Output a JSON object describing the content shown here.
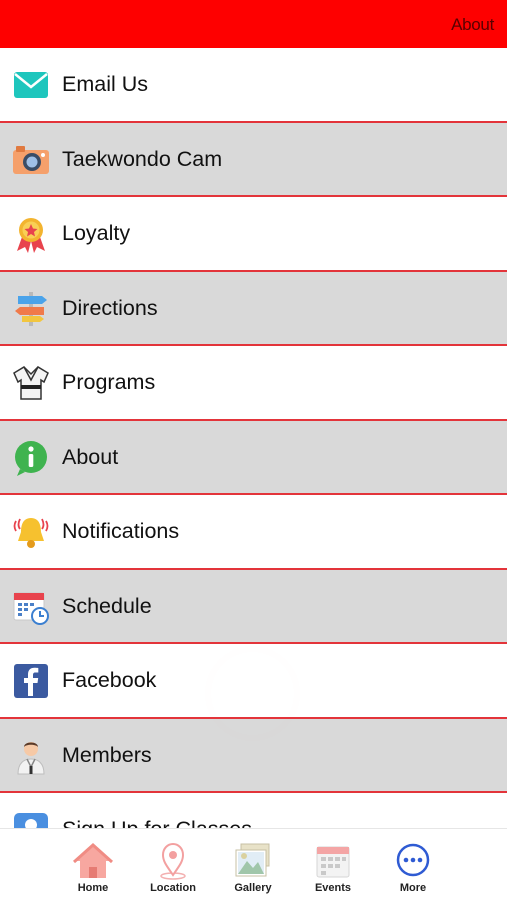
{
  "header": {
    "title": "About"
  },
  "menu": {
    "items": [
      {
        "label": "Email Us",
        "icon": "email-icon"
      },
      {
        "label": "Taekwondo Cam",
        "icon": "camera-icon"
      },
      {
        "label": "Loyalty",
        "icon": "medal-icon"
      },
      {
        "label": "Directions",
        "icon": "signpost-icon"
      },
      {
        "label": "Programs",
        "icon": "uniform-icon"
      },
      {
        "label": "About",
        "icon": "info-icon"
      },
      {
        "label": "Notifications",
        "icon": "bell-icon"
      },
      {
        "label": "Schedule",
        "icon": "calendar-clock-icon"
      },
      {
        "label": "Facebook",
        "icon": "facebook-icon"
      },
      {
        "label": "Members",
        "icon": "person-icon"
      },
      {
        "label": "Sign Up for Classes",
        "icon": "user-icon"
      }
    ]
  },
  "tabbar": {
    "tabs": [
      {
        "label": "Home",
        "icon": "home-icon"
      },
      {
        "label": "Location",
        "icon": "location-pin-icon"
      },
      {
        "label": "Gallery",
        "icon": "gallery-icon"
      },
      {
        "label": "Events",
        "icon": "calendar-icon"
      },
      {
        "label": "More",
        "icon": "more-icon"
      }
    ]
  },
  "colors": {
    "header": "#fe0000",
    "divider": "#e3343a",
    "more_blue": "#2f5bd3"
  }
}
